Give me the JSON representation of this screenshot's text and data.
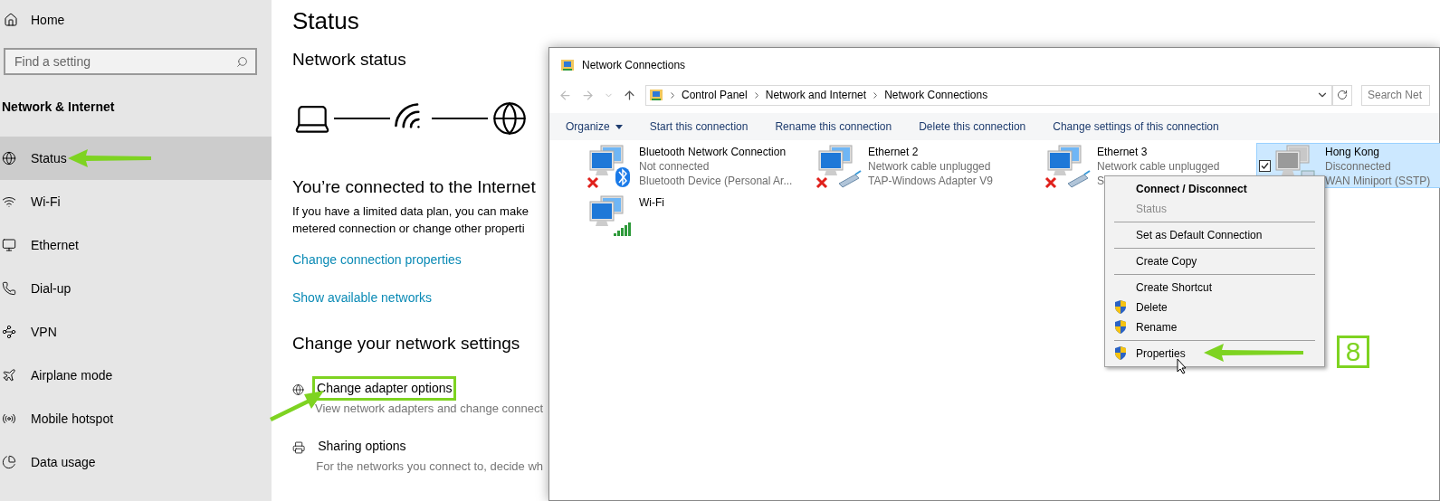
{
  "sidebar": {
    "home": "Home",
    "search": {
      "placeholder": "Find a setting"
    },
    "heading": "Network & Internet",
    "items": [
      {
        "label": "Status",
        "selected": true
      },
      {
        "label": "Wi-Fi",
        "selected": false
      },
      {
        "label": "Ethernet",
        "selected": false
      },
      {
        "label": "Dial-up",
        "selected": false
      },
      {
        "label": "VPN",
        "selected": false
      },
      {
        "label": "Airplane mode",
        "selected": false
      },
      {
        "label": "Mobile hotspot",
        "selected": false
      },
      {
        "label": "Data usage",
        "selected": false
      }
    ]
  },
  "settings": {
    "title": "Status",
    "network_status": "Network status",
    "connected_heading": "You’re connected to the Internet",
    "paragraph_lines": [
      "If you have a limited data plan, you can make",
      "metered connection or change other properti"
    ],
    "links": [
      "Change connection properties",
      "Show available networks"
    ],
    "change_heading": "Change your network settings",
    "options": [
      {
        "title": "Change adapter options",
        "subtitle": "View network adapters and change connect",
        "highlighted": true
      },
      {
        "title": "Sharing options",
        "subtitle": "For the networks you connect to, decide wh",
        "highlighted": false
      }
    ]
  },
  "window": {
    "title": "Network Connections",
    "breadcrumb": [
      "Control Panel",
      "Network and Internet",
      "Network Connections"
    ],
    "search": {
      "placeholder": "Search Net"
    },
    "toolbar": [
      {
        "label": "Organize",
        "dropdown": true
      },
      {
        "label": "Start this connection",
        "dropdown": false
      },
      {
        "label": "Rename this connection",
        "dropdown": false
      },
      {
        "label": "Delete this connection",
        "dropdown": false
      },
      {
        "label": "Change settings of this connection",
        "dropdown": false
      }
    ],
    "connections": [
      {
        "name": "Bluetooth Network Connection",
        "status": "Not connected",
        "device": "Bluetooth Device (Personal Ar...",
        "kind": "bluetooth",
        "error": true,
        "selected": false,
        "checked": false
      },
      {
        "name": "Ethernet 2",
        "status": "Network cable unplugged",
        "device": "TAP-Windows Adapter V9",
        "kind": "ethernet",
        "error": true,
        "selected": false,
        "checked": false
      },
      {
        "name": "Ethernet 3",
        "status": "Network cable unplugged",
        "device": "S",
        "kind": "ethernet",
        "error": true,
        "selected": false,
        "checked": false
      },
      {
        "name": "Hong Kong",
        "status": "Disconnected",
        "device": "WAN Miniport (SSTP)",
        "kind": "vpn",
        "error": false,
        "selected": true,
        "checked": true
      },
      {
        "name": "Wi-Fi",
        "kind": "wifi",
        "error": false,
        "selected": false,
        "checked": false
      }
    ]
  },
  "context_menu": [
    {
      "kind": "item",
      "label": "Connect / Disconnect",
      "default": true,
      "disabled": false,
      "shield": false
    },
    {
      "kind": "item",
      "label": "Status",
      "default": false,
      "disabled": true,
      "shield": false
    },
    {
      "kind": "separator"
    },
    {
      "kind": "item",
      "label": "Set as Default Connection",
      "default": false,
      "disabled": false,
      "shield": false
    },
    {
      "kind": "separator"
    },
    {
      "kind": "item",
      "label": "Create Copy",
      "default": false,
      "disabled": false,
      "shield": false
    },
    {
      "kind": "separator"
    },
    {
      "kind": "item",
      "label": "Create Shortcut",
      "default": false,
      "disabled": false,
      "shield": false
    },
    {
      "kind": "item",
      "label": "Delete",
      "default": false,
      "disabled": false,
      "shield": true
    },
    {
      "kind": "item",
      "label": "Rename",
      "default": false,
      "disabled": false,
      "shield": true
    },
    {
      "kind": "separator"
    },
    {
      "kind": "item",
      "label": "Properties",
      "default": false,
      "disabled": false,
      "shield": true
    }
  ],
  "step_badge": "8"
}
